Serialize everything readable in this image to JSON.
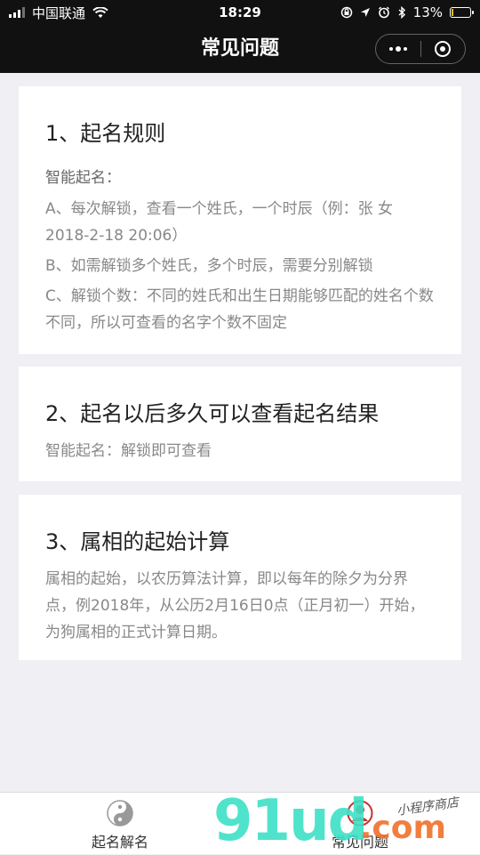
{
  "status_bar": {
    "carrier": "中国联通",
    "time": "18:29",
    "battery": "13%",
    "battery_level": 0.13,
    "icons": [
      "signal-icon",
      "wifi-icon",
      "orientation-lock-icon",
      "location-icon",
      "alarm-icon",
      "bluetooth-icon",
      "battery-icon"
    ]
  },
  "nav": {
    "title": "常见问题",
    "more_icon": "more-dots-icon",
    "close_icon": "target-circle-icon"
  },
  "sections": [
    {
      "heading": "1、起名规则",
      "subheading": "智能起名：",
      "items": [
        "A、每次解锁，查看一个姓氏，一个时辰（例：张 女 2018-2-18 20:06）",
        "B、如需解锁多个姓氏，多个时辰，需要分别解锁",
        "C、解锁个数：不同的姓氏和出生日期能够匹配的姓名个数不同，所以可查看的名字个数不固定"
      ]
    },
    {
      "heading": "2、起名以后多久可以查看起名结果",
      "body": "智能起名：解锁即可查看"
    },
    {
      "heading": "3、属相的起始计算",
      "body": "属相的起始，以农历算法计算，即以每年的除夕为分界点，例2018年，从公历2月16日0点（正月初一）开始，为狗属相的正式计算日期。"
    }
  ],
  "tabs": [
    {
      "label": "起名解名",
      "icon": "yin-yang-icon"
    },
    {
      "label": "常见问题",
      "icon": "user-circle-icon"
    }
  ],
  "watermark": {
    "brand": "91ud",
    "domain": ".com",
    "tagline": "小程序商店"
  },
  "colors": {
    "header_bg": "#111111",
    "page_bg": "#efeff4",
    "card_bg": "#ffffff",
    "body_text": "#888888",
    "battery_fill": "#f5c000"
  }
}
